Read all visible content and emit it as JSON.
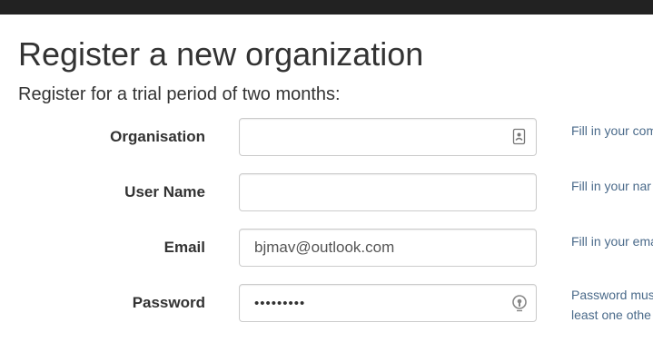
{
  "header": {
    "title": "Register a new organization",
    "subtitle": "Register for a trial period of two months:"
  },
  "form": {
    "organisation": {
      "label": "Organisation",
      "value": "",
      "icon": "contact-card-icon",
      "help": "Fill in your com"
    },
    "username": {
      "label": "User Name",
      "value": "",
      "help": "Fill in your nar"
    },
    "email": {
      "label": "Email",
      "value": "bjmav@outlook.com",
      "help": "Fill in your ema"
    },
    "password": {
      "label": "Password",
      "value": "•••••••••",
      "icon": "password-manager-icon",
      "help_line1": "Password mus",
      "help_line2": "least one othe"
    }
  },
  "colors": {
    "topbar": "#222222",
    "help_text": "#4a6a8a",
    "input_border": "#cccccc"
  }
}
